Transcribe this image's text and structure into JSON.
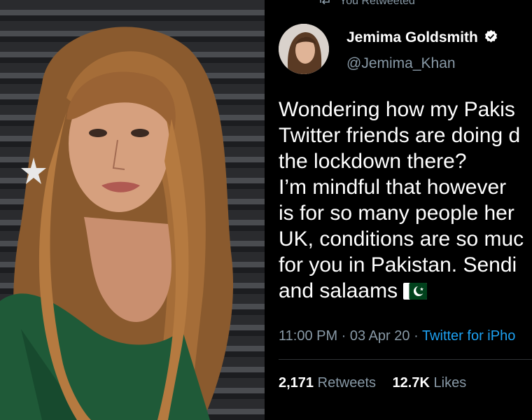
{
  "retweet_label": "You Retweeted",
  "author": {
    "name": "Jemima Goldsmith",
    "handle": "@Jemima_Khan",
    "verified": true
  },
  "tweet_lines": [
    "Wondering how my Pakis",
    "Twitter friends are doing d",
    "the lockdown there?",
    " I’m mindful that however",
    "is for so many people her",
    "UK, conditions are so muc",
    "for you in Pakistan. Sendi",
    "and salaams"
  ],
  "timestamp": "11:00 PM · 03 Apr 20 · ",
  "source": "Twitter for iPho",
  "stats": {
    "retweets_count": "2,171",
    "retweets_label": "Retweets",
    "likes_count": "12.7K",
    "likes_label": "Likes"
  },
  "colors": {
    "background": "#000000",
    "secondary_text": "#8899a6",
    "link": "#1da1f2",
    "flag_green": "#01411c"
  },
  "icons": [
    "retweet-icon",
    "verified-badge-icon",
    "pakistan-flag-icon"
  ]
}
